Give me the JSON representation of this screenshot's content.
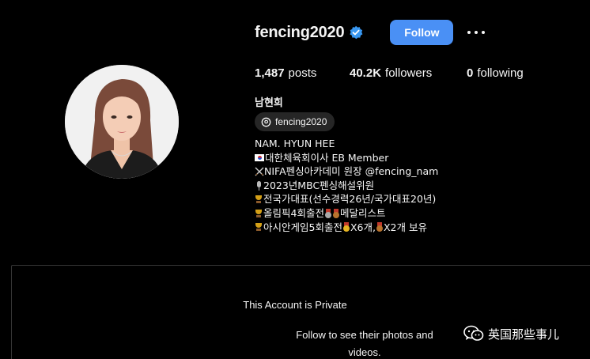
{
  "profile": {
    "username": "fencing2020",
    "verified": true,
    "follow_label": "Follow",
    "more_icon": "more-options-icon",
    "avatar_icon": "profile-photo",
    "accent_color": "#4a90f5"
  },
  "stats": {
    "posts_count": "1,487",
    "posts_label": "posts",
    "followers_count": "40.2K",
    "followers_label": "followers",
    "following_count": "0",
    "following_label": "following"
  },
  "full_name": "남현희",
  "threads_badge": {
    "icon": "threads-icon",
    "label": "fencing2020"
  },
  "bio": {
    "line1": "NAM. HYUN HEE",
    "line2": "대한체육회이사 EB Member",
    "line3": "NIFA펜싱아카데미 원장 @fencing_nam",
    "line4": "2023년MBC펜싱해설위원",
    "line5": "전국가대표(선수경력26년/국가대표20년)",
    "line6": "올림픽4회출전",
    "line6b": "메달리스트",
    "line7": "아시안게임5회출전",
    "line7b": "X6개,",
    "line7c": "X2개 보유"
  },
  "private": {
    "title": "This Account is Private",
    "subtitle": "Follow to see their photos and videos."
  },
  "watermark": {
    "text": "英国那些事儿",
    "icon": "wechat-icon"
  }
}
